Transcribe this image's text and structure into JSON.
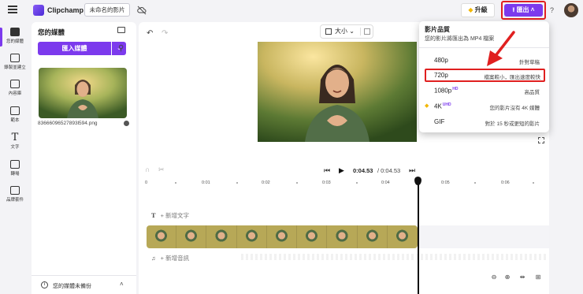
{
  "app": {
    "name": "Clipchamp",
    "project_title": "未命名的影片"
  },
  "header": {
    "upgrade_label": "升級",
    "export_label": "匯出",
    "help_label": "?"
  },
  "rail": [
    {
      "label": "您的媒體",
      "icon": "folder-icon"
    },
    {
      "label": "錄製並建立",
      "icon": "camera-icon"
    },
    {
      "label": "內容庫",
      "icon": "library-icon"
    },
    {
      "label": "範本",
      "icon": "templates-icon"
    },
    {
      "label": "文字",
      "icon": "text-icon"
    },
    {
      "label": "轉場",
      "icon": "transitions-icon"
    },
    {
      "label": "品牌套件",
      "icon": "brand-kit-icon"
    }
  ],
  "media_panel": {
    "title": "您的媒體",
    "import_label": "匯入媒體",
    "file_name": "83666096527893l594.png",
    "backup_note": "您的媒體未備份"
  },
  "editor": {
    "size_label": "大小",
    "time_current": "0:04.53",
    "time_total": "/ 0:04.53",
    "ruler_ticks": [
      "0",
      "0:01",
      "0:02",
      "0:03",
      "0:04",
      "0:05",
      "0:06",
      "0:07"
    ],
    "add_text": "+ 新增文字",
    "add_audio": "+ 新增音訊"
  },
  "export_menu": {
    "heading": "影片品質",
    "subheading": "您的影片將匯出為 MP4 檔案",
    "options": [
      {
        "quality": "480p",
        "badge": "",
        "desc": "針對草稿"
      },
      {
        "quality": "720p",
        "badge": "",
        "desc": "檔案較小，匯出速度較快"
      },
      {
        "quality": "1080p",
        "badge": "HD",
        "desc": "高品質"
      },
      {
        "quality": "4K",
        "badge": "UHD",
        "desc": "您的影片沒有 4K 媒體"
      },
      {
        "quality": "GIF",
        "badge": "",
        "desc": "對於 15 秒或更短的影片"
      }
    ]
  },
  "colors": {
    "accent": "#7c3aed",
    "highlight": "#e02020",
    "premium": "#f2b705"
  }
}
